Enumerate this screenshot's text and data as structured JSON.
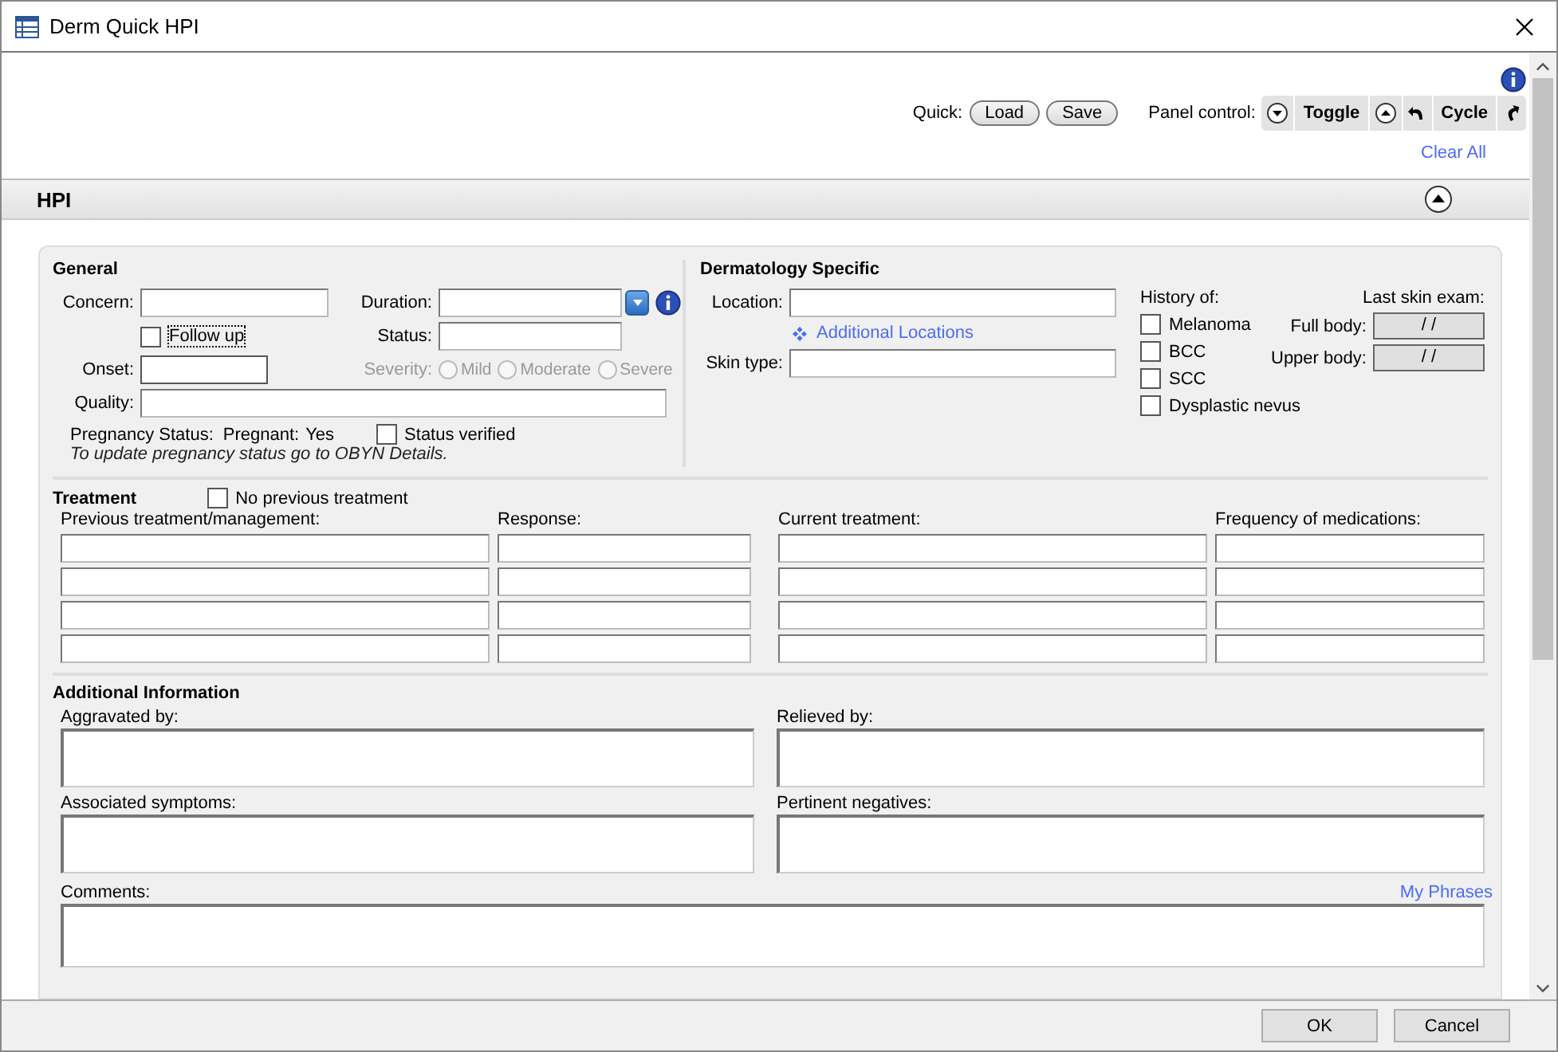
{
  "window": {
    "title": "Derm Quick HPI"
  },
  "toolbar": {
    "quick_label": "Quick:",
    "quick_buttons": [
      "Load",
      "Save"
    ],
    "panel_label": "Panel control:",
    "panel_buttons": [
      {
        "kind": "collapse"
      },
      {
        "kind": "text",
        "label": "Toggle"
      },
      {
        "kind": "expand"
      },
      {
        "kind": "undo"
      },
      {
        "kind": "text",
        "label": "Cycle"
      },
      {
        "kind": "redo"
      }
    ],
    "clear_link": "Clear All"
  },
  "section": {
    "title": "HPI",
    "expanded": true
  },
  "general": {
    "title": "General",
    "concern_label": "Concern:",
    "duration_label": "Duration:",
    "follow_up": {
      "label": "Follow up",
      "checked": false
    },
    "status_label": "Status:",
    "onset_label": "Onset:",
    "severity": {
      "label": "Severity:",
      "disabled": true,
      "options": [
        {
          "label": "Mild",
          "selected": false
        },
        {
          "label": "Moderate",
          "selected": false
        },
        {
          "label": "Severe",
          "selected": false
        }
      ]
    },
    "quality_label": "Quality:",
    "pregnancy_label": "Pregnancy Status:",
    "pregnant_label": "Pregnant:",
    "pregnant_value": "Yes",
    "status_verified": {
      "label": "Status verified",
      "checked": false
    },
    "note": "To update pregnancy status go to OBYN Details."
  },
  "derm": {
    "title": "Dermatology Specific",
    "location_label": "Location:",
    "additional_link": "Additional Locations",
    "skin_type_label": "Skin type:",
    "history_label": "History of:",
    "history": [
      {
        "label": "Melanoma",
        "checked": false
      },
      {
        "label": "BCC",
        "checked": false
      },
      {
        "label": "SCC",
        "checked": false
      },
      {
        "label": "Dysplastic nevus",
        "checked": false
      }
    ],
    "last_exam_label": "Last skin exam:",
    "exams": [
      {
        "label": "Full body:",
        "value": "/ /"
      },
      {
        "label": "Upper body:",
        "value": "/ /"
      }
    ]
  },
  "treatment": {
    "title": "Treatment",
    "no_previous": {
      "label": "No previous treatment",
      "checked": false
    },
    "columns": [
      "Previous treatment/management:",
      "Response:",
      "Current treatment:",
      "Frequency of medications:"
    ]
  },
  "additional": {
    "title": "Additional Information",
    "fields": [
      {
        "label": "Aggravated by:"
      },
      {
        "label": "Relieved by:"
      },
      {
        "label": "Associated symptoms:"
      },
      {
        "label": "Pertinent negatives:"
      }
    ],
    "comments_label": "Comments:",
    "phrases_link": "My Phrases"
  },
  "footer": {
    "buttons": [
      "OK",
      "Cancel"
    ]
  }
}
